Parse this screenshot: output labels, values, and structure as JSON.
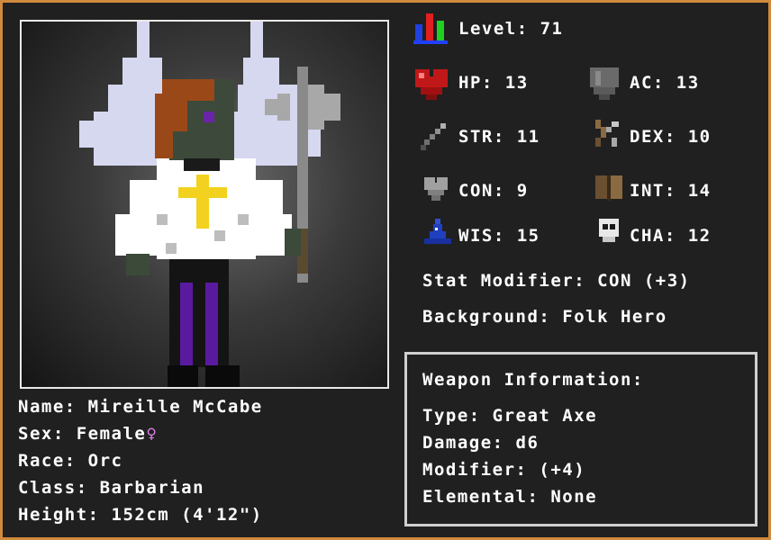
{
  "character": {
    "name_label": "Name:",
    "name": "Mireille McCabe",
    "sex_label": "Sex:",
    "sex": "Female",
    "sex_symbol": "♀",
    "race_label": "Race:",
    "race": "Orc",
    "class_label": "Class:",
    "class": "Barbarian",
    "height_label": "Height:",
    "height": "152cm (4'12\")"
  },
  "stats": {
    "level_label": "Level:",
    "level": "71",
    "hp_label": "HP:",
    "hp": "13",
    "ac_label": "AC:",
    "ac": "13",
    "str_label": "STR:",
    "str": "11",
    "dex_label": "DEX:",
    "dex": "10",
    "con_label": "CON:",
    "con": "9",
    "int_label": "INT:",
    "int": "14",
    "wis_label": "WIS:",
    "wis": "15",
    "cha_label": "CHA:",
    "cha": "12"
  },
  "modifier": {
    "label": "Stat Modifier:",
    "value": "CON (+3)"
  },
  "background": {
    "label": "Background:",
    "value": "Folk Hero"
  },
  "weapon": {
    "title": "Weapon Information:",
    "type_label": "Type:",
    "type": "Great Axe",
    "damage_label": "Damage:",
    "damage": "d6",
    "modifier_label": "Modifier:",
    "modifier": "(+4)",
    "elemental_label": "Elemental:",
    "elemental": "None"
  },
  "icons": {
    "level": "level-bars-icon",
    "hp": "heart-icon",
    "ac": "shield-icon",
    "str": "sword-icon",
    "dex": "bow-icon",
    "con": "grey-heart-icon",
    "int": "book-icon",
    "wis": "wizard-hat-icon",
    "cha": "skull-mask-icon",
    "portrait": "character-portrait"
  },
  "colors": {
    "border": "#d08a3e",
    "background": "#202020",
    "text": "#ffffff",
    "female": "#e080e8"
  }
}
